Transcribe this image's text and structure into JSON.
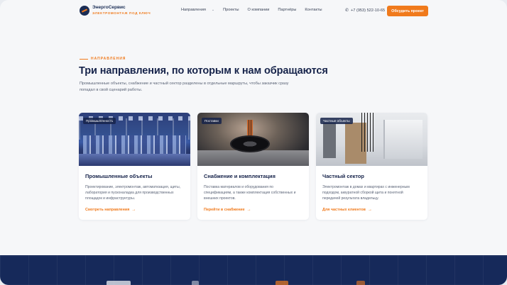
{
  "header": {
    "brand_name": "ЭнергоСервис",
    "brand_sub": "ЭЛЕКТРОМОНТАЖ ПОД КЛЮЧ",
    "nav": [
      "Направления",
      "Проекты",
      "О компании",
      "Партнёры",
      "Контакты"
    ],
    "phone": "+7 (953) 522-10-65",
    "cta": "Обсудить проект"
  },
  "section": {
    "eyebrow": "НАПРАВЛЕНИЯ",
    "title": "Три направления, по которым к нам обращаются",
    "description": "Промышленные объекты, снабжение и частный сектор разделены в отдельные маршруты, чтобы заказчик сразу попадал в свой сценарий работы."
  },
  "cards": [
    {
      "badge": "Промышленность",
      "title": "Промышленные объекты",
      "text": "Проектирование, электромонтаж, автоматизация, щиты, лаборатория и пусконаладка для производственных площадок и инфраструктуры.",
      "link": "Смотреть направления"
    },
    {
      "badge": "Поставки",
      "title": "Снабжение и комплектация",
      "text": "Поставка материалов и оборудования по спецификациям, а также комплектация собственных и внешних проектов.",
      "link": "Перейти в снабжение"
    },
    {
      "badge": "Частные объекты",
      "title": "Частный сектор",
      "text": "Электромонтаж в домах и квартирах с инженерным подходом, аккуратной сборкой щита и понятной передачей результата владельцу.",
      "link": "Для частных клиентов"
    }
  ],
  "colors": {
    "accent": "#f07a1c",
    "navy": "#16234a",
    "band": "#16295a"
  },
  "icons": {
    "phone": "phone-icon",
    "arrow": "arrow-right-icon",
    "chevron": "chevron-down-icon"
  }
}
